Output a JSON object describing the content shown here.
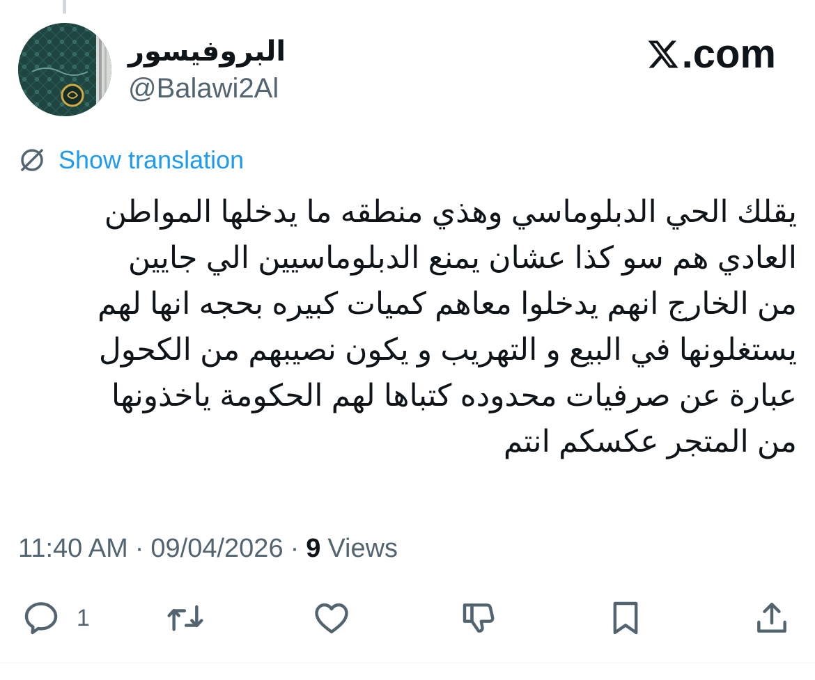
{
  "author": {
    "display_name": "البروفيسور",
    "handle": "@Balawi2Al"
  },
  "brand": {
    "text": ".com",
    "logo_icon": "x-logo-icon"
  },
  "translation": {
    "icon": "globe-icon",
    "label": "Show translation"
  },
  "tweet": {
    "lines": [
      "يقلك الحي الدبلوماسي وهذي منطقه ما يدخلها المواطن",
      "العادي هم سو كذا عشان يمنع الدبلوماسيين الي جايين",
      "من الخارج انهم يدخلوا معاهم كميات كبيره بحجه انها لهم",
      "يستغلونها في البيع و التهريب و يكون نصيبهم من الكحول",
      "عبارة عن صرفيات محدوده كتباها لهم الحكومة ياخذونها",
      "من المتجر عكسكم انتم"
    ]
  },
  "meta": {
    "time": "11:40 AM",
    "separator": "·",
    "date": "09/04/2026",
    "views_count": "9",
    "views_label": "Views"
  },
  "actions": {
    "reply": {
      "icon": "reply-icon",
      "count": "1"
    },
    "repost": {
      "icon": "repost-icon"
    },
    "like": {
      "icon": "heart-icon"
    },
    "dislike": {
      "icon": "thumbs-down-icon"
    },
    "bookmark": {
      "icon": "bookmark-icon"
    },
    "share": {
      "icon": "share-icon"
    }
  },
  "colors": {
    "link": "#1d9bf0",
    "secondary_text": "#536471",
    "primary_text": "#0f1419",
    "avatar_bg": "#1d3b3a",
    "avatar_emblem": "#d4a940"
  }
}
